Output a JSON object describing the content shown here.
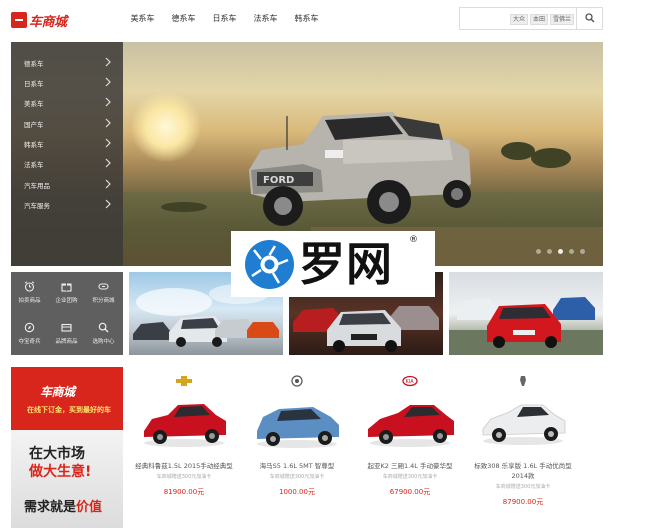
{
  "header": {
    "logo_text": "车商城",
    "nav": [
      "美系车",
      "德系车",
      "日系车",
      "法系车",
      "韩系车"
    ],
    "search": {
      "tags": [
        "大众",
        "本田",
        "雪佛兰"
      ],
      "button_icon": "search-icon"
    }
  },
  "sidebar": {
    "items": [
      {
        "label": "德系车"
      },
      {
        "label": "日系车"
      },
      {
        "label": "美系车"
      },
      {
        "label": "国产车"
      },
      {
        "label": "韩系车"
      },
      {
        "label": "法系车"
      },
      {
        "label": "汽车用品"
      },
      {
        "label": "汽车服务"
      }
    ]
  },
  "quick_tiles": [
    {
      "label": "拍卖商品",
      "icon": "alarm-clock-icon"
    },
    {
      "label": "企业团购",
      "icon": "gift-icon"
    },
    {
      "label": "积分商城",
      "icon": "exchange-icon"
    },
    {
      "label": "夺宝奇兵",
      "icon": "compass-icon"
    },
    {
      "label": "品牌商品",
      "icon": "card-icon"
    },
    {
      "label": "选购中心",
      "icon": "search-icon"
    }
  ],
  "watermark": {
    "text": "罗网",
    "reg": "®"
  },
  "ad": {
    "brand": "车商城",
    "slogan": "在线下订金，买到最好的车",
    "line1": "在大市场",
    "line2": "做大生意!",
    "footer_a": "需求就是",
    "footer_b": "价值"
  },
  "products": [
    {
      "brand": "chevrolet-logo-icon",
      "name": "经典科鲁兹1.5L 2015手动经典型",
      "sub": "车商城赠送300元加油卡",
      "price": "81900.00元",
      "color": "#c8101e"
    },
    {
      "brand": "roewe-logo-icon",
      "name": "海马S5 1.6L 5MT 智尊型",
      "sub": "车商城赠送300元加油卡",
      "price": "1000.00元",
      "color": "#5b8fc4"
    },
    {
      "brand": "kia-logo-icon",
      "name": "起亚K2 三厢1.4L 手动豪华型",
      "sub": "车商城赠送300元加油卡",
      "price": "67900.00元",
      "color": "#c8101e"
    },
    {
      "brand": "peugeot-logo-icon",
      "name": "标致308 乐享版 1.6L 手动优尚型 2014款",
      "sub": "车商城赠送300元加油卡",
      "price": "87900.00元",
      "color": "#ecedef"
    }
  ],
  "colors": {
    "accent": "#d9261c",
    "menu_bg": "#3c3a38",
    "price": "#d9261c"
  }
}
